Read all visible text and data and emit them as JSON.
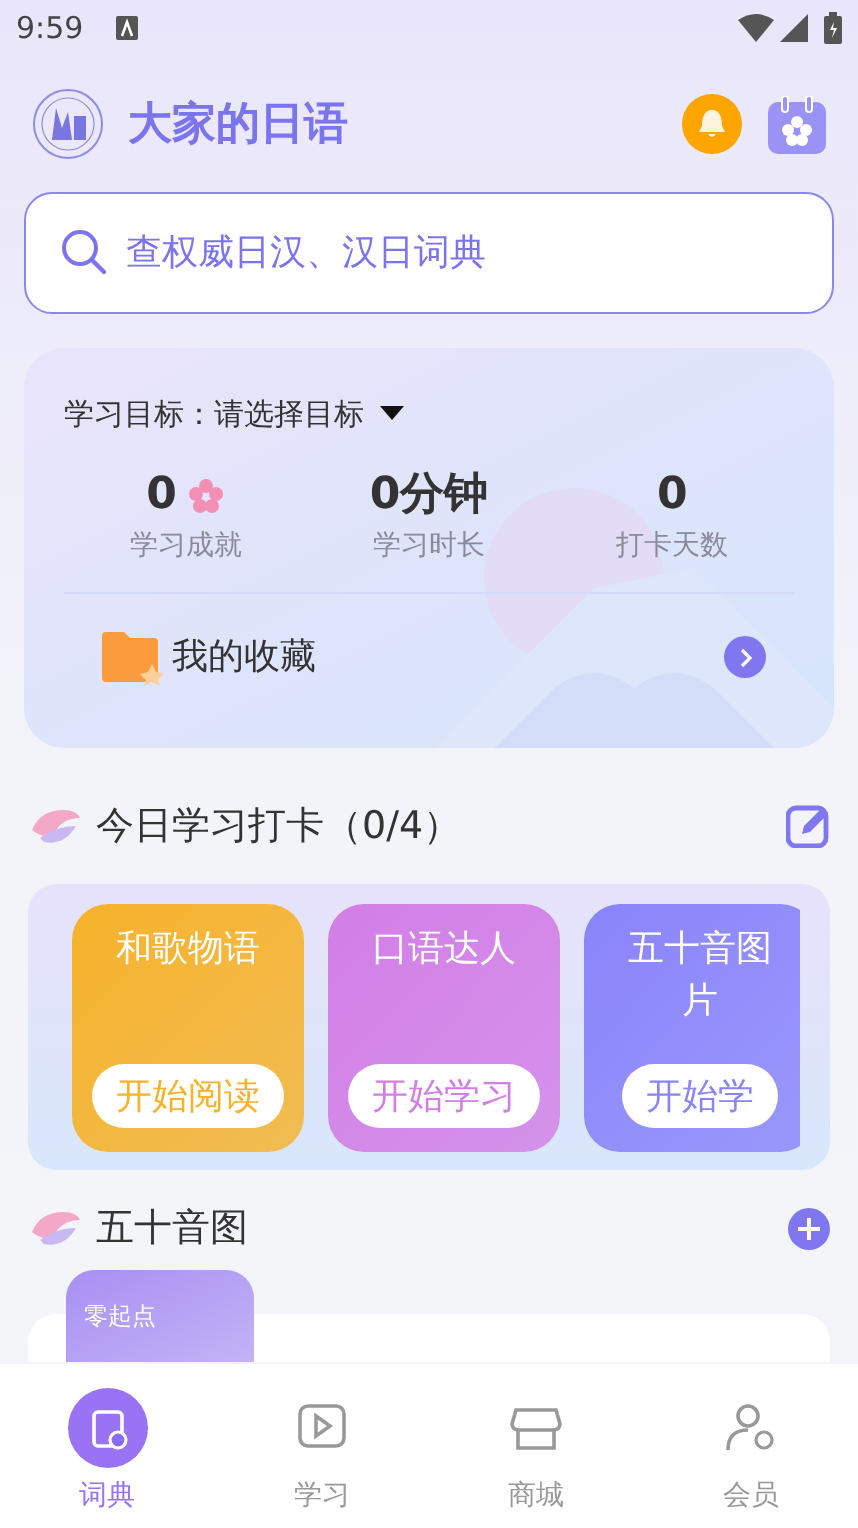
{
  "status_bar": {
    "time": "9:59"
  },
  "header": {
    "title": "大家的日语"
  },
  "search": {
    "placeholder": "查权威日汉、汉日词典"
  },
  "goal": {
    "label": "学习目标：",
    "value": "请选择目标"
  },
  "stats": [
    {
      "value": "0",
      "label": "学习成就",
      "kind": "flower"
    },
    {
      "value": "0分钟",
      "label": "学习时长",
      "kind": "plain"
    },
    {
      "value": "0",
      "label": "打卡天数",
      "kind": "plain"
    }
  ],
  "favorites": {
    "label": "我的收藏"
  },
  "checkin": {
    "title": "今日学习打卡（0/4）",
    "cards": [
      {
        "title": "和歌物语",
        "button": "开始阅读",
        "color": "#f6b22a"
      },
      {
        "title": "口语达人",
        "button": "开始学习",
        "color": "#d27ee6"
      },
      {
        "title": "五十音图片",
        "button": "开始学",
        "color": "#8a84fb"
      }
    ]
  },
  "kana": {
    "title": "五十音图",
    "thumb": "零起点"
  },
  "nav": [
    {
      "label": "词典",
      "selected": true,
      "kind": "dict"
    },
    {
      "label": "学习",
      "selected": false,
      "kind": "play"
    },
    {
      "label": "商城",
      "selected": false,
      "kind": "shop"
    },
    {
      "label": "会员",
      "selected": false,
      "kind": "member"
    }
  ]
}
